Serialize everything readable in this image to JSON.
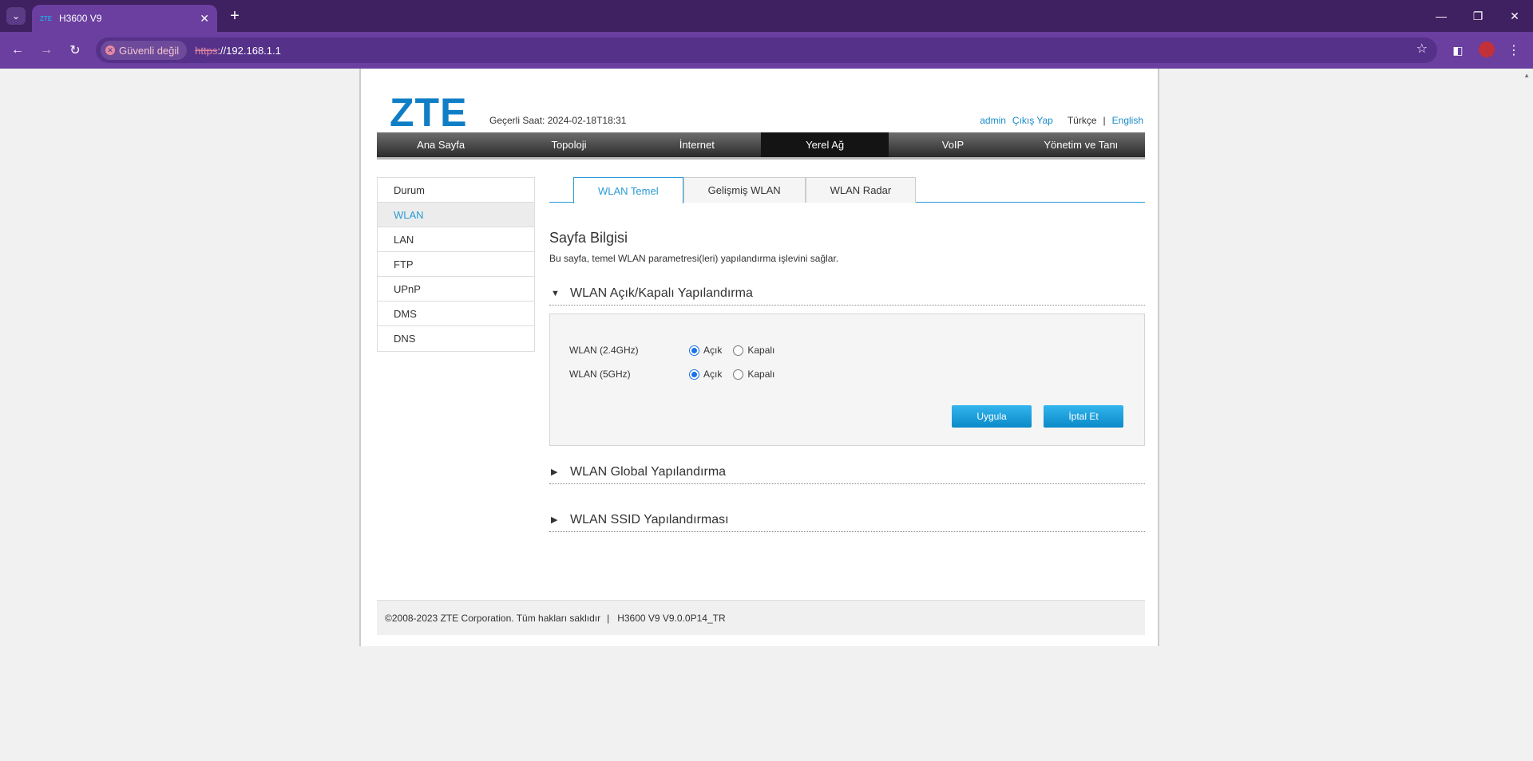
{
  "browser": {
    "tab_title": "H3600 V9",
    "tab_favicon": "ZTE",
    "security_label": "Güvenli değil",
    "url_scheme": "https",
    "url_rest": "://192.168.1.1"
  },
  "header": {
    "logo": "ZTE",
    "current_time": "Geçerli Saat: 2024-02-18T18:31",
    "user": "admin",
    "logout": "Çıkış Yap",
    "lang_current": "Türkçe",
    "lang_sep": "|",
    "lang_other": "English"
  },
  "mainnav": {
    "items": [
      "Ana Sayfa",
      "Topoloji",
      "İnternet",
      "Yerel Ağ",
      "VoIP",
      "Yönetim ve Tanı"
    ],
    "active": "Yerel Ağ"
  },
  "sidemenu": {
    "items": [
      "Durum",
      "WLAN",
      "LAN",
      "FTP",
      "UPnP",
      "DMS",
      "DNS"
    ],
    "active": "WLAN"
  },
  "subtabs": [
    "WLAN Temel",
    "Gelişmiş WLAN",
    "WLAN Radar"
  ],
  "page_info": {
    "title": "Sayfa Bilgisi",
    "desc": "Bu sayfa, temel WLAN parametresi(leri) yapılandırma işlevini sağlar."
  },
  "sections": {
    "onoff": {
      "title": "WLAN Açık/Kapalı Yapılandırma",
      "rows": [
        {
          "label": "WLAN (2.4GHz)",
          "on_label": "Açık",
          "off_label": "Kapalı",
          "value": "on"
        },
        {
          "label": "WLAN (5GHz)",
          "on_label": "Açık",
          "off_label": "Kapalı",
          "value": "on"
        }
      ],
      "apply": "Uygula",
      "cancel": "İptal Et"
    },
    "global": {
      "title": "WLAN Global Yapılandırma"
    },
    "ssid": {
      "title": "WLAN SSID Yapılandırması"
    }
  },
  "footer": {
    "copyright": "©2008-2023 ZTE Corporation. Tüm hakları saklıdır",
    "sep": "|",
    "version": "H3600 V9 V9.0.0P14_TR"
  },
  "colors": {
    "brand": "#0f7ec6",
    "accent": "#2a9bd4",
    "browser_frame": "#6a3fa0"
  }
}
